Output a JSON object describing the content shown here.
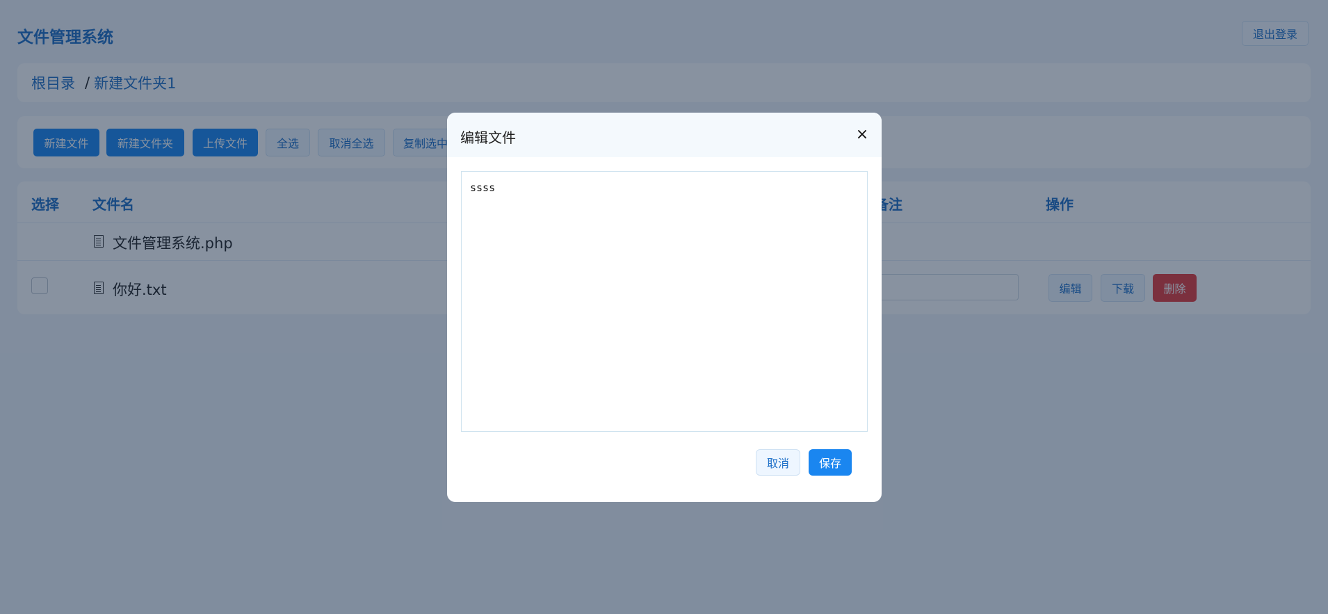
{
  "header": {
    "title": "文件管理系统",
    "logout_label": "退出登录"
  },
  "breadcrumb": {
    "root": "根目录",
    "separator": "/",
    "current": "新建文件夹1"
  },
  "toolbar": {
    "new_file": "新建文件",
    "new_folder": "新建文件夹",
    "upload": "上传文件",
    "select_all": "全选",
    "deselect_all": "取消全选",
    "copy_selected": "复制选中"
  },
  "table": {
    "headers": {
      "select": "选择",
      "filename": "文件名",
      "note": "备注",
      "actions": "操作"
    },
    "rows": [
      {
        "name": "文件管理系统.php"
      },
      {
        "name": "你好.txt",
        "edit": "编辑",
        "download": "下载",
        "delete": "删除"
      }
    ]
  },
  "modal": {
    "title": "编辑文件",
    "close": "×",
    "content": "ssss",
    "cancel": "取消",
    "save": "保存"
  },
  "colors": {
    "accent": "#1a86f0",
    "danger": "#e53a3a",
    "title": "#1f6fc5"
  }
}
